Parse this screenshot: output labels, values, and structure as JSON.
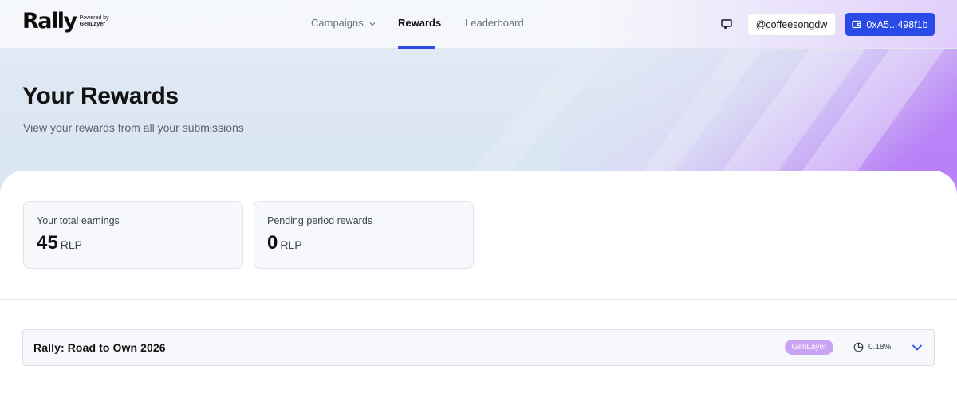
{
  "brand": {
    "name": "Rally",
    "powered_by": "Powered by",
    "powered_by_brand": "GenLayer"
  },
  "nav": {
    "items": [
      {
        "label": "Campaigns",
        "has_dropdown": true,
        "active": false
      },
      {
        "label": "Rewards",
        "active": true
      },
      {
        "label": "Leaderboard",
        "active": false
      }
    ]
  },
  "header_actions": {
    "chat_icon": "chat-icon",
    "handle": "@coffeesongdw",
    "wallet_icon": "wallet-icon",
    "wallet": "0xA5...498f1b"
  },
  "hero": {
    "title": "Your Rewards",
    "subtitle": "View your rewards from all your submissions"
  },
  "stats": [
    {
      "label": "Your total earnings",
      "value": "45",
      "unit": "RLP"
    },
    {
      "label": "Pending period rewards",
      "value": "0",
      "unit": "RLP"
    }
  ],
  "campaigns": [
    {
      "name": "Rally: Road to Own 2026",
      "tag": "GenLayer",
      "share_icon": "pie-chart-icon",
      "share": "0.18%",
      "expand_icon": "chevron-down-icon"
    }
  ],
  "colors": {
    "accent": "#2a4be8",
    "badge": "#c9a4f4",
    "hero_bg": "#dce7f3",
    "purple_glow": "#b77cf7"
  }
}
